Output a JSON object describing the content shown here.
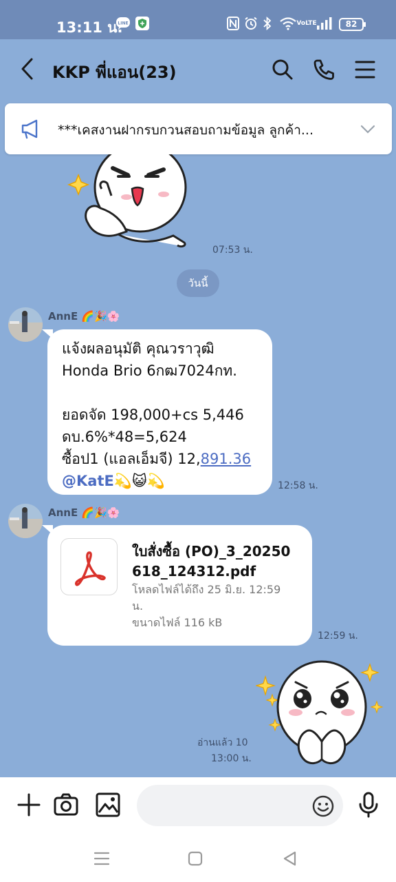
{
  "status_bar": {
    "time": "13:11 น.",
    "network_label": "VoLTE",
    "battery": "82",
    "icons": [
      "line-icon",
      "shield-app-icon",
      "nfc-icon",
      "alarm-icon",
      "bluetooth-icon",
      "wifi-icon",
      "signal-icon",
      "battery-icon"
    ]
  },
  "header": {
    "title": "KKP พี่แอน(23)",
    "icons": [
      "back-arrow-icon",
      "search-icon",
      "phone-icon",
      "menu-icon"
    ]
  },
  "announcement": {
    "text": "***เคสงานฝากรบกวนสอบถามข้อมูล ลูกค้า..."
  },
  "messages": {
    "sticker1_time": "07:53 น.",
    "date_chip": "วันนี้",
    "msg1": {
      "sender": "AnnE 🌈🎉🌸",
      "line1": "แจ้งผลอนุมัติ คุณวราวุฒิ",
      "line2": "Honda Brio 6กฒ7024กท.",
      "line3": "ยอดจัด 198,000+cs 5,446",
      "line4": "ดบ.6%*48=5,624",
      "line5_prefix": "ซื้อป1 (แอลเอ็มจี) 12,",
      "line5_link": "891.36",
      "mention": "@KatE",
      "emoji_after_mention": "💫😺💫",
      "time": "12:58 น."
    },
    "msg2": {
      "sender": "AnnE 🌈🎉🌸",
      "file_name_line1": "ใบสั่งซื้อ (PO)_3_20250",
      "file_name_line2": "618_124312.pdf",
      "download_line1": "โหลดไฟล์ได้ถึง 25 มิ.ย. 12:59",
      "download_line2": "น.",
      "file_size": "ขนาดไฟล์ 116 kB",
      "time": "12:59 น."
    },
    "sticker2_read": "อ่านแล้ว 10",
    "sticker2_time": "13:00 น."
  },
  "composer": {
    "placeholder": "",
    "icons": [
      "plus-icon",
      "camera-icon",
      "gallery-icon",
      "emoji-icon",
      "microphone-icon"
    ]
  },
  "colors": {
    "chat_background": "#8badd8",
    "status_bar": "#6f8bb8",
    "link": "#4c6cc2",
    "pdf_red": "#d9322b"
  }
}
